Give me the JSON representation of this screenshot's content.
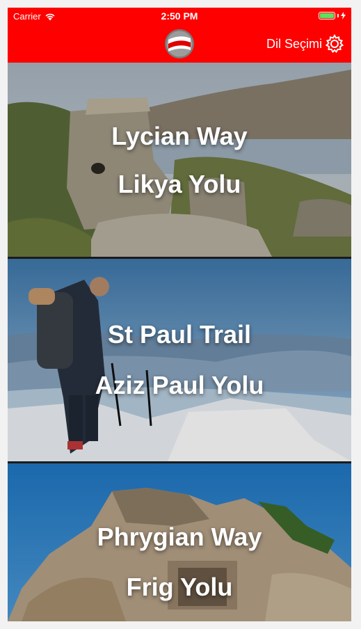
{
  "status_bar": {
    "carrier": "Carrier",
    "time": "2:50 PM"
  },
  "nav": {
    "language_label": "Dil Seçimi",
    "logo_icon": "route-flag-logo",
    "settings_icon": "gear-icon",
    "brand_color": "#ff0000"
  },
  "routes": [
    {
      "name_en": "Lycian Way",
      "name_tr": "Likya Yolu"
    },
    {
      "name_en": "St Paul Trail",
      "name_tr": "Aziz Paul Yolu"
    },
    {
      "name_en": "Phrygian Way",
      "name_tr": "Frig Yolu"
    }
  ]
}
